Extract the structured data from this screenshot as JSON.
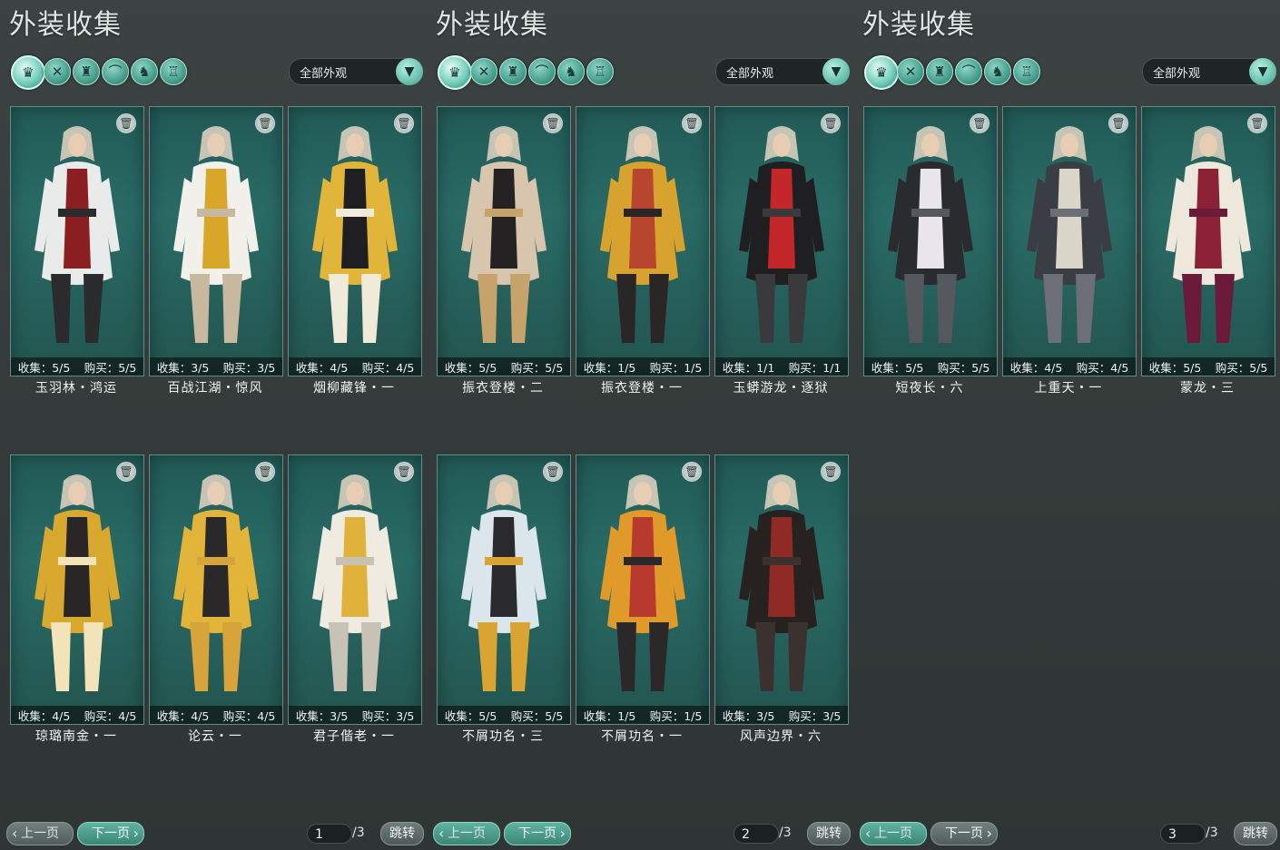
{
  "colors": {
    "accent": "#5fb9a6",
    "card_bg": "#2a6b66",
    "background": "#353b3a"
  },
  "filter_icons": [
    "outfit-icon",
    "top-icon",
    "armor-icon",
    "boots-icon",
    "mask-icon",
    "accessory-icon"
  ],
  "panels": [
    {
      "title": "外装收集",
      "dropdown": "全部外观",
      "pagination": {
        "prev": "上一页",
        "next": "下一页",
        "current": "1",
        "total": "/3",
        "jump": "跳转"
      },
      "cards": [
        {
          "collect": "收集：5/5",
          "buy": "购买：5/5",
          "name": "玉羽林・鸿运",
          "palette": [
            "#e9eaea",
            "#8c1f22",
            "#2b2b2e"
          ]
        },
        {
          "collect": "收集：3/5",
          "buy": "购买：3/5",
          "name": "百战江湖・惊风",
          "palette": [
            "#f1f0ea",
            "#d8a629",
            "#c8b8a0"
          ]
        },
        {
          "collect": "收集：4/5",
          "buy": "购买：4/5",
          "name": "烟柳藏锋・一",
          "palette": [
            "#e0b53a",
            "#1f1f22",
            "#f0ead8"
          ]
        },
        {
          "collect": "收集：4/5",
          "buy": "购买：4/5",
          "name": "琼璐南金・一",
          "palette": [
            "#d9a82f",
            "#2a2526",
            "#f2e3b8"
          ]
        },
        {
          "collect": "收集：4/5",
          "buy": "购买：4/5",
          "name": "论云・一",
          "palette": [
            "#e3b43a",
            "#2b2829",
            "#d6a43a"
          ]
        },
        {
          "collect": "收集：3/5",
          "buy": "购买：3/5",
          "name": "君子偕老・一",
          "palette": [
            "#f0ebe0",
            "#e0b23c",
            "#c8c2b5"
          ]
        }
      ]
    },
    {
      "title": "外装收集",
      "dropdown": "全部外观",
      "pagination": {
        "prev": "上一页",
        "next": "下一页",
        "current": "2",
        "total": "/3",
        "jump": "跳转"
      },
      "cards": [
        {
          "collect": "收集：5/5",
          "buy": "购买：5/5",
          "name": "振衣登楼・二",
          "palette": [
            "#d7c6ad",
            "#242223",
            "#c5a36b"
          ]
        },
        {
          "collect": "收集：1/5",
          "buy": "购买：1/5",
          "name": "振衣登楼・一",
          "palette": [
            "#d8a22f",
            "#b8452e",
            "#2b2626"
          ]
        },
        {
          "collect": "收集：1/1",
          "buy": "购买：1/1",
          "name": "玉蟒游龙・逐狱",
          "palette": [
            "#1f1f22",
            "#c4272a",
            "#3a3a3d"
          ]
        },
        {
          "collect": "收集：5/5",
          "buy": "购买：5/5",
          "name": "不屑功名・三",
          "palette": [
            "#dbe6ec",
            "#2a2a2c",
            "#d9a432"
          ]
        },
        {
          "collect": "收集：1/5",
          "buy": "购买：1/5",
          "name": "不屑功名・一",
          "palette": [
            "#df9a2a",
            "#b8392e",
            "#2a2828"
          ]
        },
        {
          "collect": "收集：3/5",
          "buy": "购买：3/5",
          "name": "风声边界・六",
          "palette": [
            "#27211f",
            "#8f2a25",
            "#3b3230"
          ]
        }
      ]
    },
    {
      "title": "外装收集",
      "dropdown": "全部外观",
      "pagination": {
        "prev": "上一页",
        "next": "下一页",
        "current": "3",
        "total": "/3",
        "jump": "跳转"
      },
      "cards": [
        {
          "collect": "收集：5/5",
          "buy": "购买：5/5",
          "name": "短夜长・六",
          "palette": [
            "#2a2b2e",
            "#e8e5ec",
            "#55585c"
          ]
        },
        {
          "collect": "收集：4/5",
          "buy": "购买：4/5",
          "name": "上重天・一",
          "palette": [
            "#3a3d44",
            "#d9d5c8",
            "#6c6f77"
          ]
        },
        {
          "collect": "收集：5/5",
          "buy": "购买：5/5",
          "name": "蒙龙・三",
          "palette": [
            "#eee8dc",
            "#8a2134",
            "#6b1a3a"
          ]
        }
      ]
    }
  ]
}
